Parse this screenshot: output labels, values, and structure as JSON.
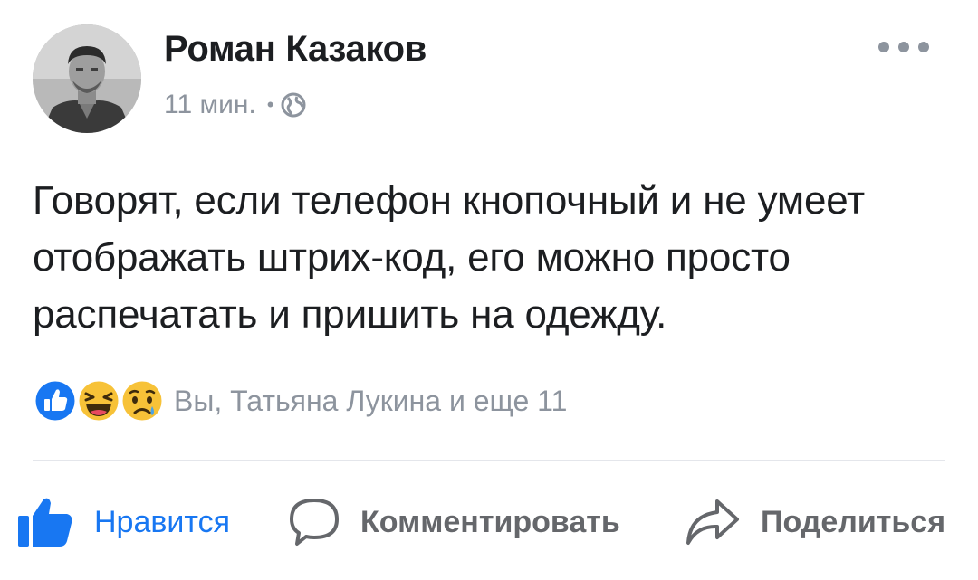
{
  "post": {
    "author": "Роман Казаков",
    "time": "11 мин.",
    "separator": "•",
    "privacy_icon": "globe-icon",
    "text": "Говорят, если телефон кнопочный и не умеет отображать штрих-код, его можно просто распечатать и пришить на одежду."
  },
  "reactions": {
    "icons": [
      "like-reaction-icon",
      "haha-reaction-icon",
      "sad-reaction-icon"
    ],
    "summary": "Вы, Татьяна Лукина и еще 11"
  },
  "actions": {
    "like_label": "Нравится",
    "comment_label": "Комментировать",
    "share_label": "Поделиться"
  },
  "colors": {
    "accent": "#1877f2",
    "text": "#1c1e21",
    "muted": "#8d949e",
    "action_grey": "#65676b",
    "haha_yellow": "#f7c238",
    "divider": "#e4e6eb"
  }
}
